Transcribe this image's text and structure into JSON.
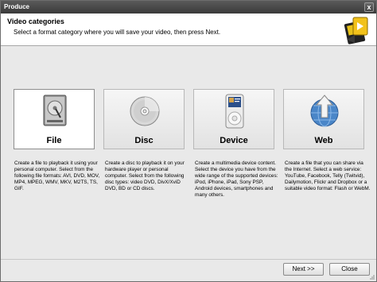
{
  "window": {
    "title": "Produce",
    "close_glyph": "x"
  },
  "header": {
    "title": "Video categories",
    "subtitle": "Select a format category where you will save your video, then press Next.",
    "logo_icon": "produce-logo-icon"
  },
  "cards": [
    {
      "label": "File",
      "icon": "hard-drive-icon",
      "description": "Create a file to playback it using your personal computer. Select from the following file formats: AVI, DVD, MOV, MP4, MPEG, WMV, MKV, M2TS, TS, GIF."
    },
    {
      "label": "Disc",
      "icon": "disc-icon",
      "description": "Create a disc to playback it on your hardware player or personal computer. Select from the following disc types: video DVD, DivX/XviD DVD, BD or CD discs."
    },
    {
      "label": "Device",
      "icon": "ipod-icon",
      "description": "Create a multimedia device content. Select the device you have from the wide range of the supported devices: iPod, iPhone, iPad, Sony PSP, Android devices, smartphones and many others."
    },
    {
      "label": "Web",
      "icon": "globe-arrow-icon",
      "description": "Create a file that you can share via the Internet. Select a web service: YouTube, Facebook, Telly (Twitvid), Dailymotion, Flickr and Dropbox or a suitable video format: Flash or WebM."
    }
  ],
  "footer": {
    "next_label": "Next >>",
    "close_label": "Close"
  }
}
